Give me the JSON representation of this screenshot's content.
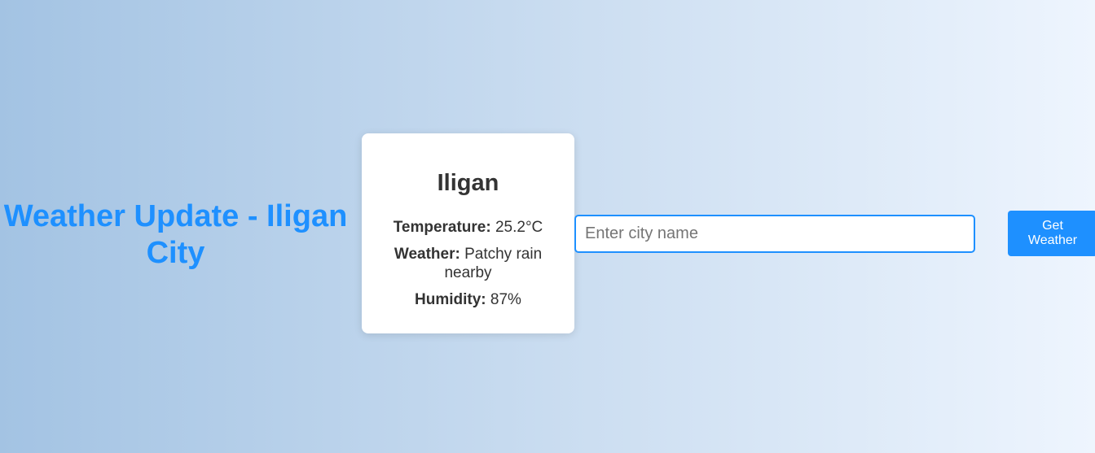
{
  "header": {
    "title": "Weather Update - Iligan City"
  },
  "weather_card": {
    "city": "Iligan",
    "temperature_label": "Temperature:",
    "temperature_value": "25.2°C",
    "weather_label": "Weather:",
    "weather_value": "Patchy rain nearby",
    "humidity_label": "Humidity:",
    "humidity_value": "87%"
  },
  "search": {
    "placeholder": "Enter city name",
    "value": ""
  },
  "actions": {
    "get_weather_label": "Get Weather"
  },
  "colors": {
    "accent": "#1e90ff",
    "text": "#333333",
    "card_background": "#ffffff"
  }
}
